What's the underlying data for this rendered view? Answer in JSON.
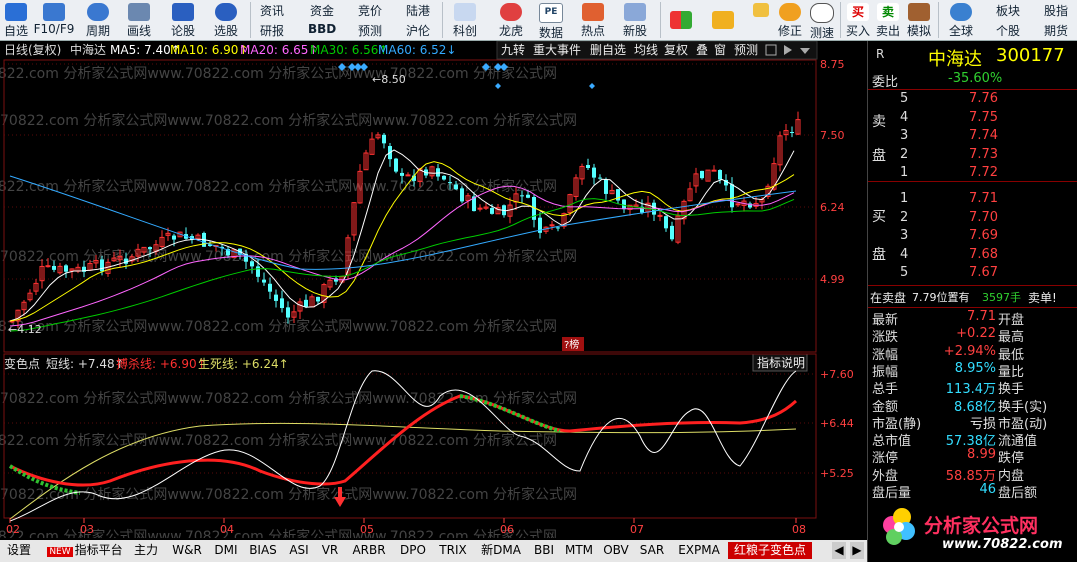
{
  "toolbar": {
    "items": [
      {
        "label": "自选",
        "icon": "star-icon"
      },
      {
        "label": "F10/F9",
        "icon": "document-icon"
      },
      {
        "label": "周期",
        "icon": "clock-icon"
      },
      {
        "label": "画线",
        "icon": "pencil-icon"
      },
      {
        "label": "论股",
        "icon": "chat-icon"
      },
      {
        "label": "选股",
        "icon": "filter-icon"
      }
    ],
    "grid_top": [
      "资讯",
      "资金",
      "竞价",
      "陆港"
    ],
    "grid_bottom": [
      "研报",
      "BBD",
      "预测",
      "沪伦"
    ],
    "items2": [
      {
        "label": "科创",
        "icon": "chart-icon"
      },
      {
        "label": "龙虎",
        "icon": "dragon-icon"
      },
      {
        "label": "数据",
        "icon": "pe-icon"
      },
      {
        "label": "热点",
        "icon": "fire-icon"
      },
      {
        "label": "新股",
        "icon": "ipo-icon"
      }
    ],
    "items3": [
      {
        "label": "",
        "icon": "windows-icon"
      },
      {
        "label": "",
        "icon": "back-arrow-icon"
      },
      {
        "label": "修正",
        "icon": "refresh-icon"
      },
      {
        "label": "测速",
        "icon": "stopwatch-icon"
      },
      {
        "label": "买入",
        "icon": "buy-icon",
        "text": "买"
      },
      {
        "label": "卖出",
        "icon": "sell-icon",
        "text": "卖"
      },
      {
        "label": "模拟",
        "icon": "hammer-icon"
      },
      {
        "label": "全球",
        "icon": "globe-icon"
      }
    ],
    "right_top": [
      "板块",
      "股指"
    ],
    "right_bottom": [
      "个股",
      "期货"
    ]
  },
  "chart_header": {
    "period": "日线(复权)",
    "name": "中海达",
    "ma5": "MA5: 7.40↑",
    "ma10": "MA10: 6.90↑",
    "ma20": "MA20: 6.65↑",
    "ma30": "MA30: 6.56↑",
    "ma60": "MA60: 6.52↓",
    "buttons": [
      "九转",
      "重大事件",
      "删自选",
      "均线",
      "复权",
      "叠",
      "窗",
      "预测"
    ]
  },
  "price_axis": [
    "8.75",
    "7.50",
    "6.24",
    "4.99"
  ],
  "annot_high": "←8.50",
  "annot_low": "←4.12",
  "rank_tag": "?榜",
  "indicator_header": {
    "name": "变色点",
    "short": "短线: +7.48↑",
    "kill": "搏杀线: +6.90↑",
    "life": "生死线: +6.24↑",
    "button": "指标说明"
  },
  "ind_axis": [
    "+7.60",
    "+6.44",
    "+5.25"
  ],
  "date_axis": [
    "02",
    "03",
    "04",
    "05",
    "06",
    "07",
    "08"
  ],
  "watermark": "70822.com 分析家公式网www.70822.com 分析家公式网www.70822.com 分析家公式网",
  "bottom_tabs": [
    "设置",
    "指标平台",
    "主力",
    "W&R",
    "DMI",
    "BIAS",
    "ASI",
    "VR",
    "ARBR",
    "DPO",
    "TRIX",
    "新DMA",
    "BBI",
    "MTM",
    "OBV",
    "SAR",
    "EXPMA",
    "红粮子变色点"
  ],
  "new_badge": "NEW",
  "quote": {
    "r": "R",
    "name": "中海达",
    "code": "300177",
    "weibi_label": "委比",
    "weibi": "-35.60%",
    "sell_label": [
      "卖",
      "盘"
    ],
    "buy_label": [
      "买",
      "盘"
    ],
    "asks": [
      {
        "lvl": "5",
        "price": "7.76"
      },
      {
        "lvl": "4",
        "price": "7.75"
      },
      {
        "lvl": "3",
        "price": "7.74"
      },
      {
        "lvl": "2",
        "price": "7.73"
      },
      {
        "lvl": "1",
        "price": "7.72"
      }
    ],
    "bids": [
      {
        "lvl": "1",
        "price": "7.71"
      },
      {
        "lvl": "2",
        "price": "7.70"
      },
      {
        "lvl": "3",
        "price": "7.69"
      },
      {
        "lvl": "4",
        "price": "7.68"
      },
      {
        "lvl": "5",
        "price": "7.67"
      }
    ],
    "notice_a": "在卖盘",
    "notice_b": "7.79位置有",
    "notice_c": "3597手",
    "notice_d": "卖单!",
    "stats": [
      {
        "l1": "最新",
        "v1": "7.71",
        "c1": "red",
        "l2": "开盘",
        "v2": ""
      },
      {
        "l1": "涨跌",
        "v1": "+0.22",
        "c1": "red",
        "l2": "最高",
        "v2": ""
      },
      {
        "l1": "涨幅",
        "v1": "+2.94%",
        "c1": "red",
        "l2": "最低",
        "v2": ""
      },
      {
        "l1": "振幅",
        "v1": "8.95%",
        "c1": "cyan",
        "l2": "量比",
        "v2": ""
      },
      {
        "l1": "总手",
        "v1": "113.4万",
        "c1": "cyan",
        "l2": "换手",
        "v2": ""
      },
      {
        "l1": "金额",
        "v1": "8.68亿",
        "c1": "cyan",
        "l2": "换手(实)",
        "v2": ""
      },
      {
        "l1": "市盈(静)",
        "v1": "亏损",
        "c1": "white",
        "l2": "市盈(动)",
        "v2": ""
      },
      {
        "l1": "总市值",
        "v1": "57.38亿",
        "c1": "cyan",
        "l2": "流通值",
        "v2": ""
      },
      {
        "l1": "涨停",
        "v1": "8.99",
        "c1": "red",
        "l2": "跌停",
        "v2": ""
      },
      {
        "l1": "外盘",
        "v1": "58.85万",
        "c1": "red",
        "l2": "内盘",
        "v2": ""
      },
      {
        "l1": "盘后量",
        "v1": "46",
        "c1": "cyan",
        "l2": "盘后额",
        "v2": ""
      }
    ]
  },
  "logo": {
    "title": "分析家公式网",
    "url": "www.70822.com"
  },
  "colors": {
    "up": "#ff3232",
    "down": "#54ffff",
    "ma5": "#ffffff",
    "ma10": "#ffff00",
    "ma20": "#ff66ff",
    "ma30": "#00cc00",
    "ma60": "#33aaff",
    "kill": "#ff2020",
    "life": "#dddd66"
  }
}
